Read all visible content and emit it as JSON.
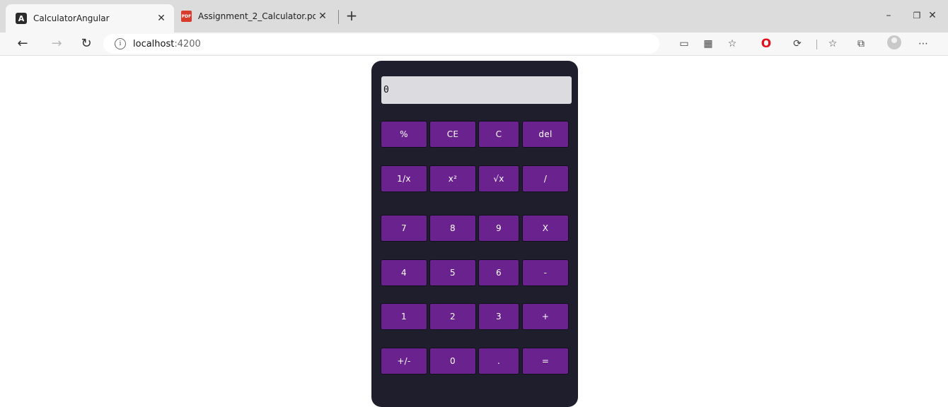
{
  "browser": {
    "tabs": [
      {
        "title": "CalculatorAngular",
        "favicon": "angular-icon",
        "active": true
      },
      {
        "title": "Assignment_2_Calculator.pdf",
        "favicon": "pdf-icon",
        "active": false
      }
    ],
    "address": {
      "host": "localhost",
      "port": ":4200"
    },
    "window_controls": {
      "minimize": "–",
      "restore": "❐",
      "close": "✕"
    }
  },
  "calculator": {
    "display": "0",
    "keys": [
      [
        "%",
        "CE",
        "C",
        "del"
      ],
      [
        "1/x",
        "x²",
        "√x",
        "/"
      ],
      [
        "7",
        "8",
        "9",
        "X"
      ],
      [
        "4",
        "5",
        "6",
        "-"
      ],
      [
        "1",
        "2",
        "3",
        "+"
      ],
      [
        "+/-",
        "0",
        ".",
        "="
      ]
    ]
  },
  "colors": {
    "calculator_body": "#1f1e2c",
    "key_background": "#6a238e",
    "display_background": "#dcdbe0"
  }
}
